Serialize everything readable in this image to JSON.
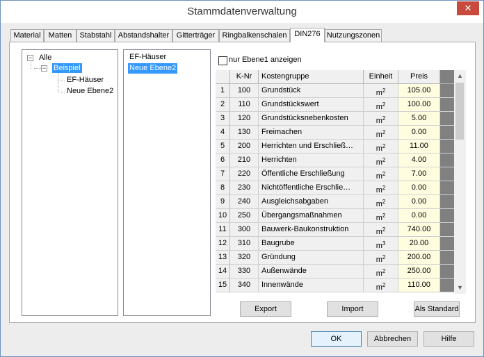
{
  "window": {
    "title": "Stammdatenverwaltung",
    "close_glyph": "✕"
  },
  "tabs": [
    {
      "label": "Material"
    },
    {
      "label": "Matten"
    },
    {
      "label": "Stabstahl"
    },
    {
      "label": "Abstandshalter"
    },
    {
      "label": "Gitterträger"
    },
    {
      "label": "Ringbalkenschalen"
    },
    {
      "label": "DIN276",
      "active": true
    },
    {
      "label": "Nutzungszonen"
    }
  ],
  "tree": {
    "root": "Alle",
    "child": "Beispiel",
    "leaves": [
      "EF-Häuser",
      "Neue Ebene2"
    ],
    "collapse_glyph": "−"
  },
  "list": {
    "items": [
      "EF-Häuser",
      "Neue Ebene2"
    ],
    "selected_index": 1
  },
  "filter": {
    "checkbox_label": "nur Ebene1 anzeigen",
    "checked": false
  },
  "grid": {
    "headers": {
      "idx": "",
      "knr": "K-Nr",
      "name": "Kostengruppe",
      "unit": "Einheit",
      "price": "Preis"
    },
    "rows": [
      {
        "idx": "1",
        "knr": "100",
        "name": "Grundstück",
        "unit_base": "m",
        "unit_exp": "2",
        "price": "105.00"
      },
      {
        "idx": "2",
        "knr": "110",
        "name": "Grundstückswert",
        "unit_base": "m",
        "unit_exp": "2",
        "price": "100.00"
      },
      {
        "idx": "3",
        "knr": "120",
        "name": "Grundstücksnebenkosten",
        "unit_base": "m",
        "unit_exp": "2",
        "price": "5.00"
      },
      {
        "idx": "4",
        "knr": "130",
        "name": "Freimachen",
        "unit_base": "m",
        "unit_exp": "2",
        "price": "0.00"
      },
      {
        "idx": "5",
        "knr": "200",
        "name": "Herrichten und Erschließ…",
        "unit_base": "m",
        "unit_exp": "2",
        "price": "11.00"
      },
      {
        "idx": "6",
        "knr": "210",
        "name": "Herrichten",
        "unit_base": "m",
        "unit_exp": "2",
        "price": "4.00"
      },
      {
        "idx": "7",
        "knr": "220",
        "name": "Öffentliche Erschließung",
        "unit_base": "m",
        "unit_exp": "2",
        "price": "7.00"
      },
      {
        "idx": "8",
        "knr": "230",
        "name": "Nichtöffentliche Erschlie…",
        "unit_base": "m",
        "unit_exp": "2",
        "price": "0.00"
      },
      {
        "idx": "9",
        "knr": "240",
        "name": "Ausgleichsabgaben",
        "unit_base": "m",
        "unit_exp": "2",
        "price": "0.00"
      },
      {
        "idx": "10",
        "knr": "250",
        "name": "Übergangsmaßnahmen",
        "unit_base": "m",
        "unit_exp": "2",
        "price": "0.00"
      },
      {
        "idx": "11",
        "knr": "300",
        "name": "Bauwerk-Baukonstruktion",
        "unit_base": "m",
        "unit_exp": "2",
        "price": "740.00"
      },
      {
        "idx": "12",
        "knr": "310",
        "name": "Baugrube",
        "unit_base": "m",
        "unit_exp": "3",
        "price": "20.00"
      },
      {
        "idx": "13",
        "knr": "320",
        "name": "Gründung",
        "unit_base": "m",
        "unit_exp": "2",
        "price": "200.00"
      },
      {
        "idx": "14",
        "knr": "330",
        "name": "Außenwände",
        "unit_base": "m",
        "unit_exp": "2",
        "price": "250.00"
      },
      {
        "idx": "15",
        "knr": "340",
        "name": "Innenwände",
        "unit_base": "m",
        "unit_exp": "2",
        "price": "110.00"
      }
    ]
  },
  "scroll": {
    "up_glyph": "▲",
    "down_glyph": "▼"
  },
  "buttons": {
    "export": "Export",
    "import": "Import",
    "as_standard": "Als Standard",
    "ok": "OK",
    "cancel": "Abbrechen",
    "help": "Hilfe"
  }
}
